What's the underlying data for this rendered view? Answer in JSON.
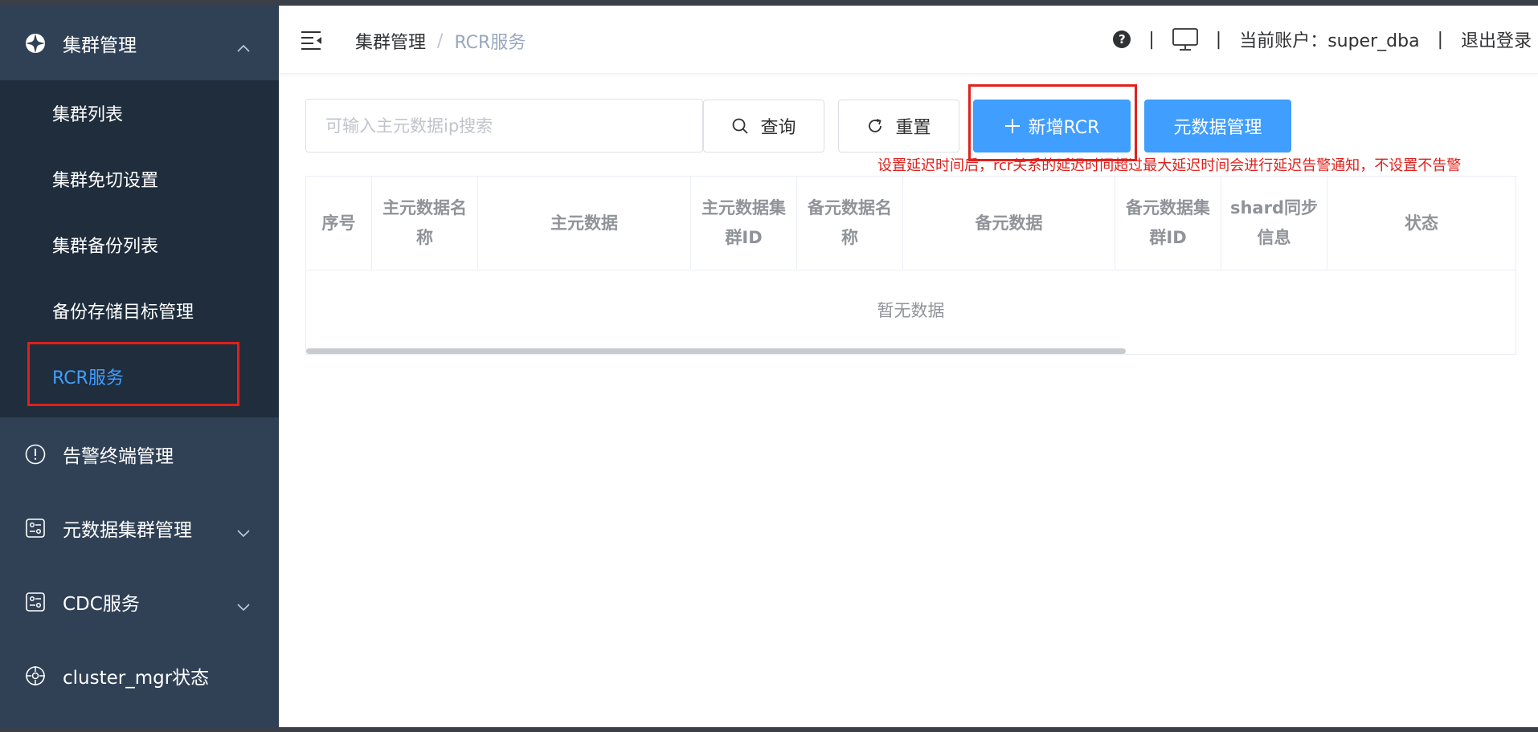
{
  "sidebar": {
    "cluster_menu": {
      "label": "集群管理",
      "icon": "cluster-icon",
      "expanded": true
    },
    "cluster_sub_items": [
      {
        "label": "集群列表"
      },
      {
        "label": "集群免切设置"
      },
      {
        "label": "集群备份列表"
      },
      {
        "label": "备份存储目标管理"
      },
      {
        "label": "RCR服务",
        "active": true
      }
    ],
    "items": [
      {
        "label": "告警终端管理",
        "icon": "alert-icon"
      },
      {
        "label": "元数据集群管理",
        "icon": "metadata-icon",
        "has_arrow": true
      },
      {
        "label": "CDC服务",
        "icon": "cdc-icon",
        "has_arrow": true
      },
      {
        "label": "cluster_mgr状态",
        "icon": "status-icon"
      }
    ]
  },
  "header": {
    "breadcrumb": {
      "parent": "集群管理",
      "separator": "/",
      "current": "RCR服务"
    },
    "divider": "|",
    "account": "当前账户：super_dba",
    "logout": "退出登录"
  },
  "toolbar": {
    "search_placeholder": "可输入主元数据ip搜索",
    "query_label": "查询",
    "reset_label": "重置",
    "add_label": "新增RCR",
    "metadata_label": "元数据管理",
    "hint": "设置延迟时间后，rcr关系的延迟时间超过最大延迟时间会进行延迟告警通知，不设置不告警"
  },
  "table": {
    "columns": [
      {
        "label": "序号"
      },
      {
        "label": "主元数据名称"
      },
      {
        "label": "主元数据"
      },
      {
        "label": "主元数据集群ID"
      },
      {
        "label": "备元数据名称"
      },
      {
        "label": "备元数据"
      },
      {
        "label": "备元数据集群ID"
      },
      {
        "label": "shard同步信息"
      },
      {
        "label": "状态"
      }
    ],
    "empty_text": "暂无数据"
  },
  "colors": {
    "sidebar": "#304156",
    "submenu": "#1f2d3d",
    "primary": "#409eff",
    "highlight": "#e0201c"
  }
}
